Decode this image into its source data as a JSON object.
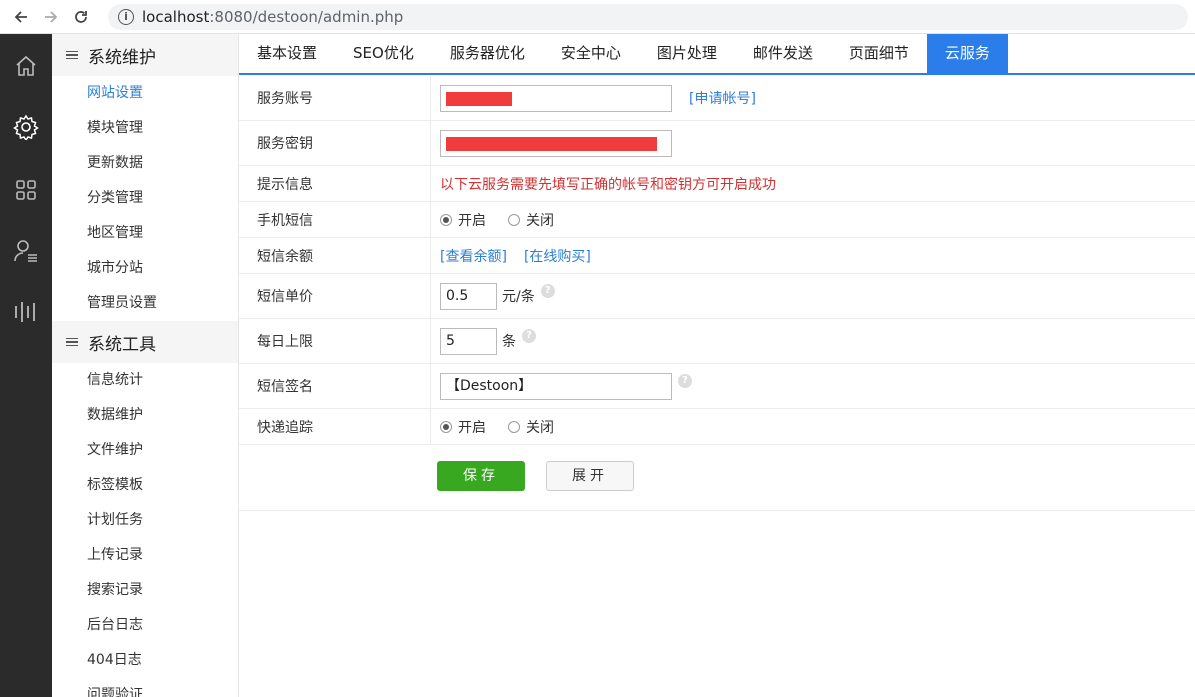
{
  "browser": {
    "url_host": "localhost",
    "url_rest": ":8080/destoon/admin.php"
  },
  "rail": [
    "home-icon",
    "gear-icon",
    "grid-icon",
    "user-list-icon",
    "bars-icon"
  ],
  "sidebar": {
    "groups": [
      {
        "title": "系统维护",
        "items": [
          "网站设置",
          "模块管理",
          "更新数据",
          "分类管理",
          "地区管理",
          "城市分站",
          "管理员设置"
        ]
      },
      {
        "title": "系统工具",
        "items": [
          "信息统计",
          "数据维护",
          "文件维护",
          "标签模板",
          "计划任务",
          "上传记录",
          "搜索记录",
          "后台日志",
          "404日志",
          "问题验证"
        ]
      }
    ]
  },
  "tabs": [
    "基本设置",
    "SEO优化",
    "服务器优化",
    "安全中心",
    "图片处理",
    "邮件发送",
    "页面细节",
    "云服务"
  ],
  "form": {
    "account_label": "服务账号",
    "apply_link": "[申请帐号]",
    "key_label": "服务密钥",
    "tip_label": "提示信息",
    "tip_text": "以下云服务需要先填写正确的帐号和密钥方可开启成功",
    "sms_label": "手机短信",
    "on": "开启",
    "off": "关闭",
    "balance_label": "短信余额",
    "check_balance": "[查看余额]",
    "buy_online": "[在线购买]",
    "price_label": "短信单价",
    "price_value": "0.5",
    "price_unit": "元/条",
    "limit_label": "每日上限",
    "limit_value": "5",
    "limit_unit": "条",
    "sign_label": "短信签名",
    "sign_value": "【Destoon】",
    "express_label": "快递追踪",
    "help": "?"
  },
  "actions": {
    "save": "保存",
    "expand": "展开"
  }
}
